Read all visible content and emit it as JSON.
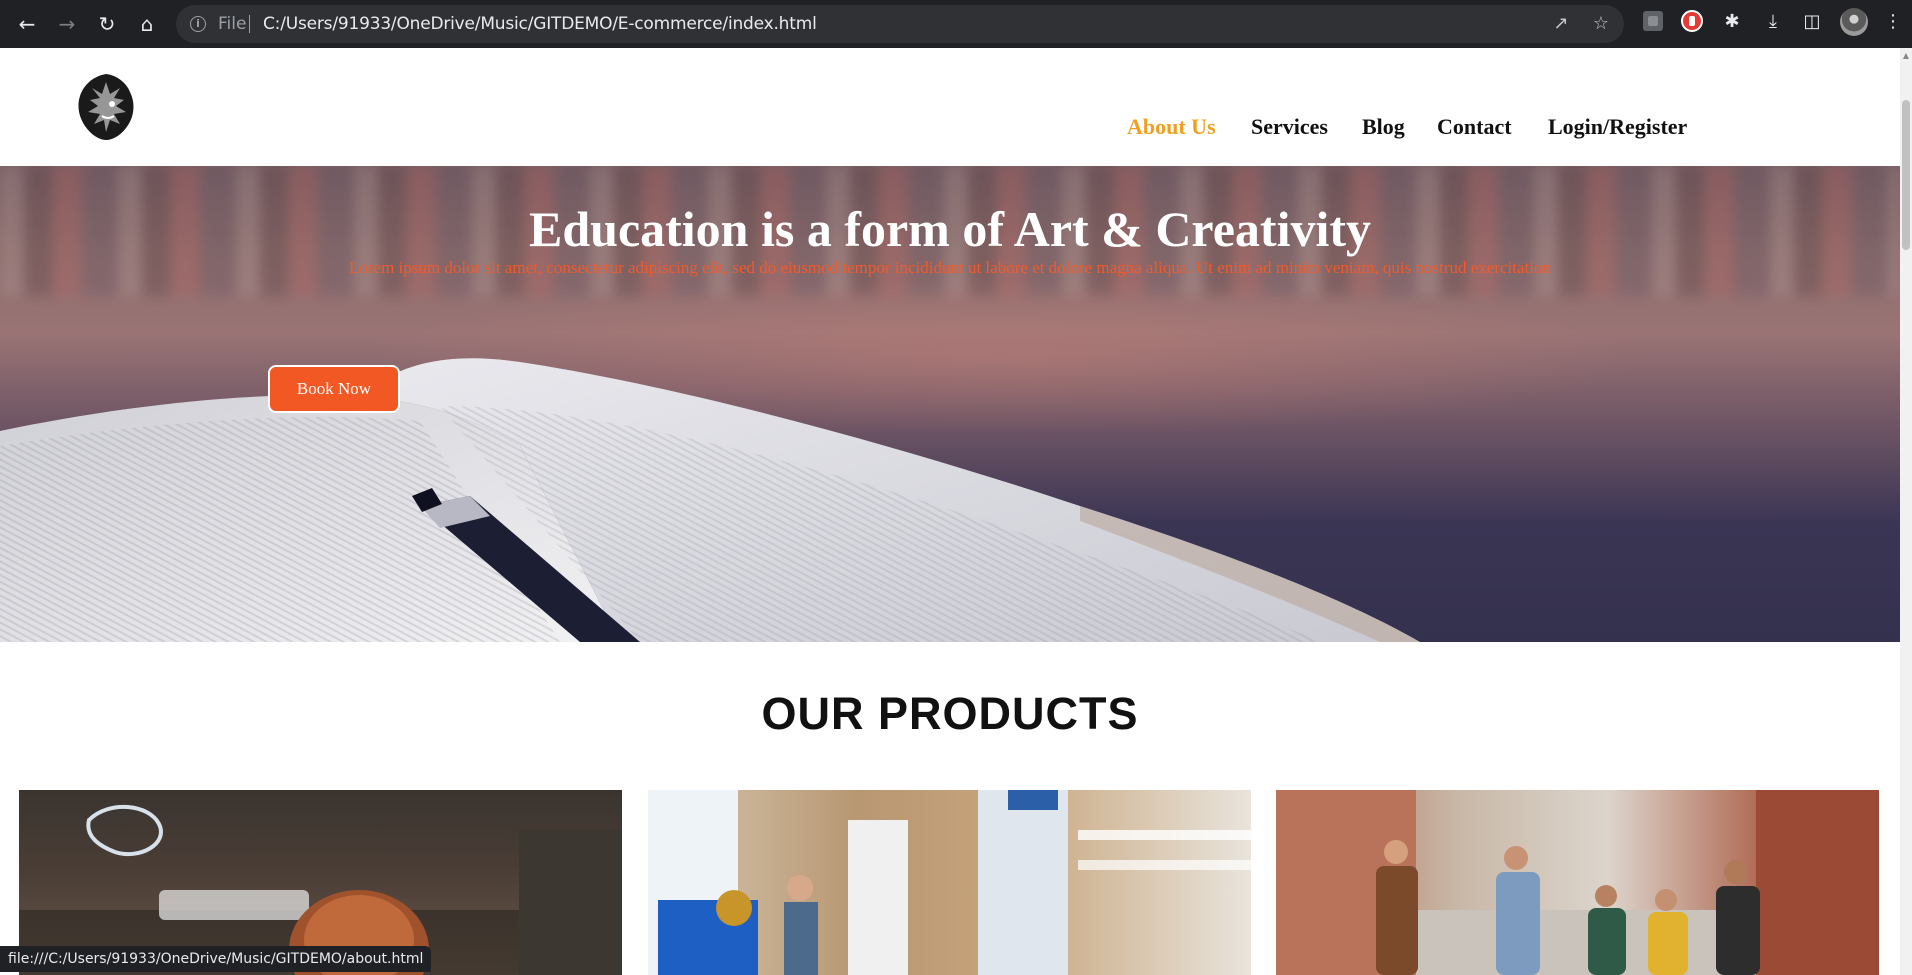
{
  "browser": {
    "file_label": "File",
    "url": "C:/Users/91933/OneDrive/Music/GITDEMO/E-commerce/index.html",
    "status_url": "file:///C:/Users/91933/OneDrive/Music/GITDEMO/about.html",
    "icons": [
      "back-arrow-icon",
      "forward-arrow-icon",
      "reload-icon",
      "home-icon",
      "info-icon",
      "share-icon",
      "bookmark-star-icon",
      "extension-icon",
      "puzzle-icon",
      "download-icon",
      "side-panel-icon",
      "profile-avatar",
      "menu-dots-icon"
    ]
  },
  "nav": {
    "items": [
      {
        "label": "About Us",
        "active": true
      },
      {
        "label": "Services"
      },
      {
        "label": "Blog"
      },
      {
        "label": "Contact"
      },
      {
        "label": "Login/Register"
      }
    ]
  },
  "hero": {
    "title": "Education is a form of Art & Creativity",
    "subtitle": "Lorem ipsum dolor sit amet, consectetur adipiscing elit, sed do eiusmod tempor incididunt ut labore et dolore magna aliqua. Ut enim ad minim veniam, quis nostrud exercitation",
    "button_label": "Book Now"
  },
  "products": {
    "heading": "OUR PRODUCTS",
    "cards": [
      {
        "image": "coffee-shop-photo"
      },
      {
        "image": "office-presentation-photo"
      },
      {
        "image": "friends-walking-photo"
      }
    ]
  },
  "colors": {
    "accent_orange": "#f25824",
    "active_nav": "#f0a020",
    "chrome_dark": "#202124"
  }
}
